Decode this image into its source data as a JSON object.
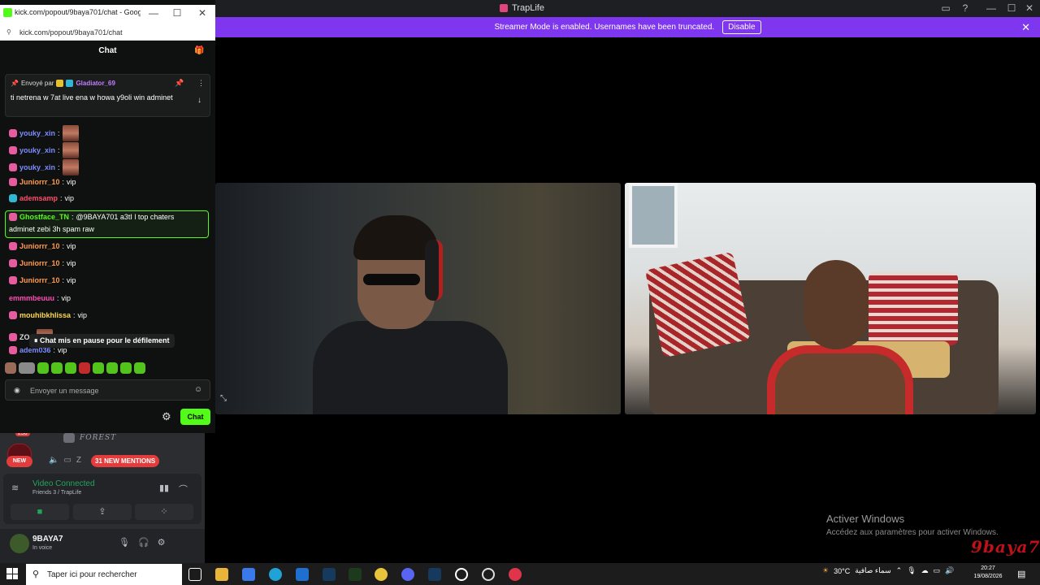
{
  "main_window": {
    "title": "TrapLife",
    "controls": {
      "minimize": "—",
      "maximize": "☐",
      "close": "✕"
    }
  },
  "streamer_banner": {
    "text": "Streamer Mode is enabled. Usernames have been truncated.",
    "disable_label": "Disable",
    "close": "✕"
  },
  "activation": {
    "title": "Activer Windows",
    "subtitle": "Accédez aux paramètres pour activer Windows."
  },
  "watermark": "9baya7",
  "sidebar": {
    "badge_count": "236",
    "new_label": "NEW",
    "server_name": "FOREST",
    "truncated_user": "Z",
    "mentions_label": "31 NEW MENTIONS",
    "voice": {
      "status": "Video Connected",
      "channel": "Friends 3 / TrapLife"
    },
    "user": {
      "name": "9BAYA7",
      "status": "In voice"
    }
  },
  "chat_window": {
    "window_title": "kick.com/popout/9baya701/chat - Google...",
    "url": "kick.com/popout/9baya701/chat",
    "heading": "Chat",
    "pinned": {
      "prefix": "Envoyé par",
      "user": "Gladiator_69",
      "text": "ti netrena w 7at live ena w howa y9oli win adminet"
    },
    "messages": [
      {
        "user": "youky_xin",
        "text": "",
        "color": "#7d8cff",
        "emote": true,
        "badge": "pink"
      },
      {
        "user": "youky_xin",
        "text": "",
        "color": "#7d8cff",
        "emote": true,
        "badge": "pink"
      },
      {
        "user": "youky_xin",
        "text": "",
        "color": "#7d8cff",
        "emote": true,
        "badge": "pink"
      },
      {
        "user": "Juniorrr_10",
        "text": "vip",
        "color": "#ff9a4d",
        "emote": false,
        "badge": "pink"
      },
      {
        "user": "ademsamp",
        "text": "vip",
        "color": "#ff4d6a",
        "emote": false,
        "badge": "sub"
      },
      {
        "user": "Ghostface_TN",
        "text": "@9BAYA701 a3tI l top chaters",
        "text2": "adminet zebi 3h spam raw",
        "color": "#53fc18",
        "emote": false,
        "badge": "pink",
        "highlight": true
      },
      {
        "user": "Juniorrr_10",
        "text": "vip",
        "color": "#ff9a4d",
        "emote": false,
        "badge": "pink"
      },
      {
        "user": "Juniorrr_10",
        "text": "vip",
        "color": "#ff9a4d",
        "emote": false,
        "badge": "pink"
      },
      {
        "user": "Juniorrr_10",
        "text": "vip",
        "color": "#ff9a4d",
        "emote": false,
        "badge": "pink"
      },
      {
        "user": "emmmbeuuu",
        "text": "vip",
        "color": "#ff4db8",
        "emote": false,
        "badge": "none"
      },
      {
        "user": "mouhibkhlissa",
        "text": "vip",
        "color": "#ffd84d",
        "emote": false,
        "badge": "pink"
      },
      {
        "user": "ZO",
        "text": "",
        "color": "#dddddd",
        "emote": true,
        "badge": "pink"
      },
      {
        "user": "adem036",
        "text": "vip",
        "color": "#7d8cff",
        "emote": false,
        "badge": "pink"
      }
    ],
    "pause_tip": "Chat mis en pause pour le défilement",
    "input_placeholder": "Envoyer un message",
    "send_label": "Chat"
  },
  "taskbar": {
    "search_placeholder": "Taper ici pour rechercher",
    "weather": "30°C",
    "weather_desc": "سماء صافية",
    "time": "20:27",
    "date": "19/08/2026"
  }
}
